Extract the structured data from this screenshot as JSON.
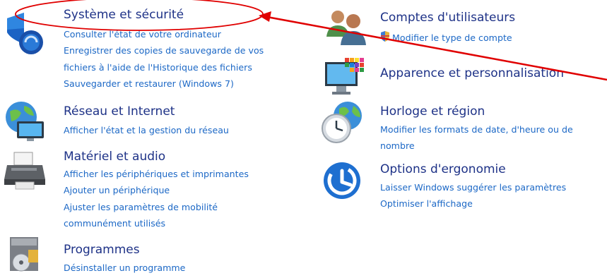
{
  "categories": [
    {
      "name": "system-security",
      "icon": "shield-icon",
      "title": "Système et sécurité",
      "links": [
        "Consulter l'état de votre ordinateur",
        "Enregistrer des copies de sauvegarde de vos",
        "fichiers à l'aide de l'Historique des fichiers",
        "Sauvegarder et restaurer (Windows 7)"
      ]
    },
    {
      "name": "network-internet",
      "icon": "network-globe-icon",
      "title": "Réseau et Internet",
      "links": [
        "Afficher l'état et la gestion du réseau"
      ]
    },
    {
      "name": "hardware-sound",
      "icon": "printer-icon",
      "title": "Matériel et audio",
      "links": [
        "Afficher les périphériques et imprimantes",
        "Ajouter un périphérique",
        "Ajuster les paramètres de mobilité",
        "communément utilisés"
      ]
    },
    {
      "name": "programs",
      "icon": "programs-disc-icon",
      "title": "Programmes",
      "links": [
        "Désinstaller un programme"
      ]
    },
    {
      "name": "user-accounts",
      "icon": "users-icon",
      "title": "Comptes d'utilisateurs",
      "links": [
        "Modifier le type de compte"
      ],
      "link_icon": "uac-shield-icon"
    },
    {
      "name": "appearance",
      "icon": "monitor-palette-icon",
      "title": "Apparence et personnalisation",
      "links": []
    },
    {
      "name": "clock-region",
      "icon": "clock-globe-icon",
      "title": "Horloge et région",
      "links": [
        "Modifier les formats de date, d'heure ou de",
        "nombre"
      ]
    },
    {
      "name": "ease-of-access",
      "icon": "ease-of-access-icon",
      "title": "Options d'ergonomie",
      "links": [
        "Laisser Windows suggérer les paramètres",
        "Optimiser l'affichage"
      ]
    }
  ],
  "annotation": {
    "icon": "red-circle-arrow-annotation",
    "color": "#e00000"
  },
  "colors": {
    "title": "#1e3287",
    "link": "#1c68c6"
  }
}
